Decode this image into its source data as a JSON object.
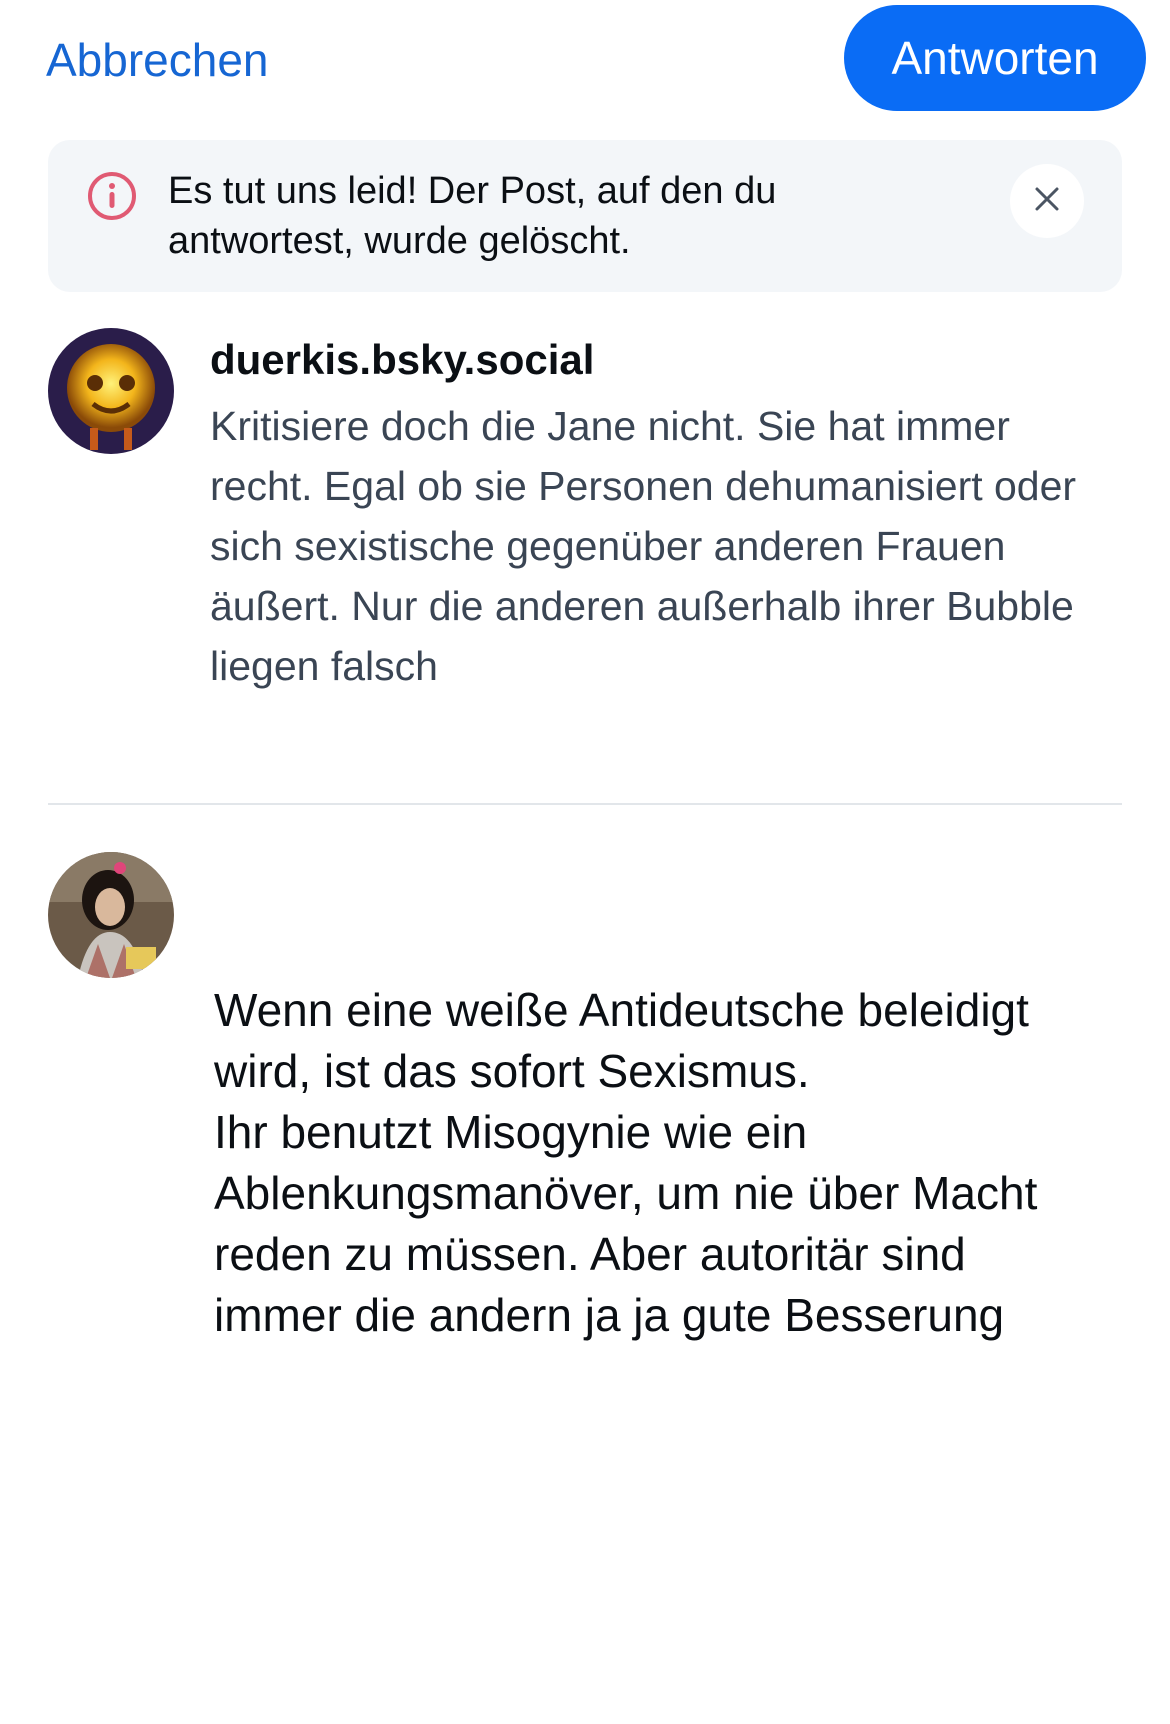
{
  "header": {
    "cancel_label": "Abbrechen",
    "reply_label": "Antworten",
    "accent_color": "#0a6cf5"
  },
  "notice": {
    "icon": "info-circle-icon",
    "icon_color": "#e05a73",
    "text": "Es tut uns leid! Der Post, auf den du antwortest, wurde gelöscht.",
    "close_icon": "close-icon"
  },
  "parent_post": {
    "handle": "duerkis.bsky.social",
    "text": "Kritisiere doch die Jane nicht. Sie hat immer recht. Egal ob sie Personen dehumanisiert oder sich sexistische gegenüber anderen Frauen äußert. Nur die anderen außerhalb ihrer Bubble liegen falsch"
  },
  "composer": {
    "text": "Wenn eine weiße Antideutsche beleidigt wird, ist das sofort Sexismus.\nIhr benutzt Misogynie wie ein Ablenkungsmanöver, um nie über Macht reden zu müssen. Aber autoritär sind immer die andern ja ja gute Besserung"
  }
}
